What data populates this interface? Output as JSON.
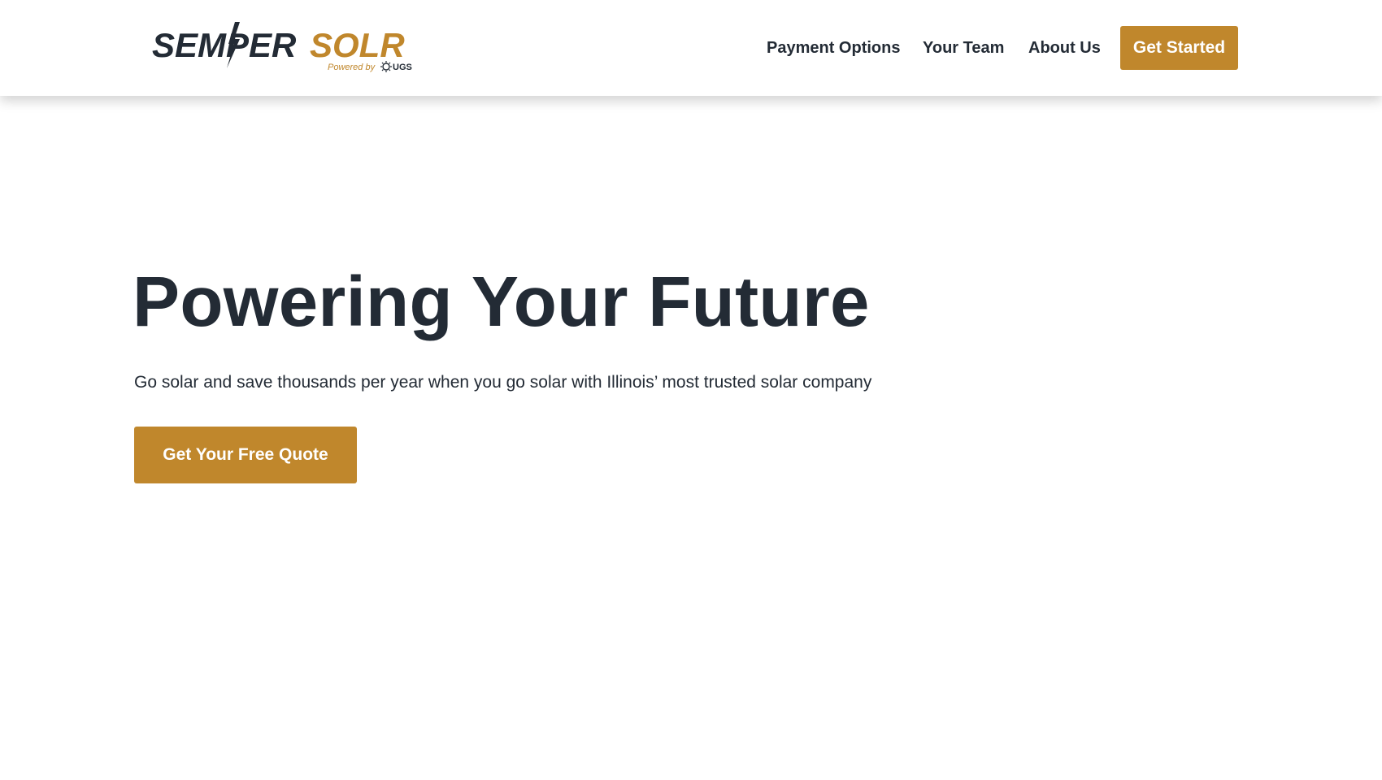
{
  "header": {
    "logo": {
      "brand_primary": "SEMPER",
      "brand_secondary": "SOLR",
      "tagline": "Powered by",
      "partner": "UGS"
    },
    "nav": [
      {
        "label": "Payment Options"
      },
      {
        "label": "Your Team"
      },
      {
        "label": "About Us"
      }
    ],
    "cta_label": "Get Started"
  },
  "hero": {
    "title": "Powering Your Future",
    "subtitle": "Go solar and save thousands per year when you go solar with Illinois’ most trusted solar company",
    "cta_label": "Get Your Free Quote"
  },
  "colors": {
    "accent": "#c0872c",
    "text": "#232b35",
    "background": "#ffffff"
  }
}
